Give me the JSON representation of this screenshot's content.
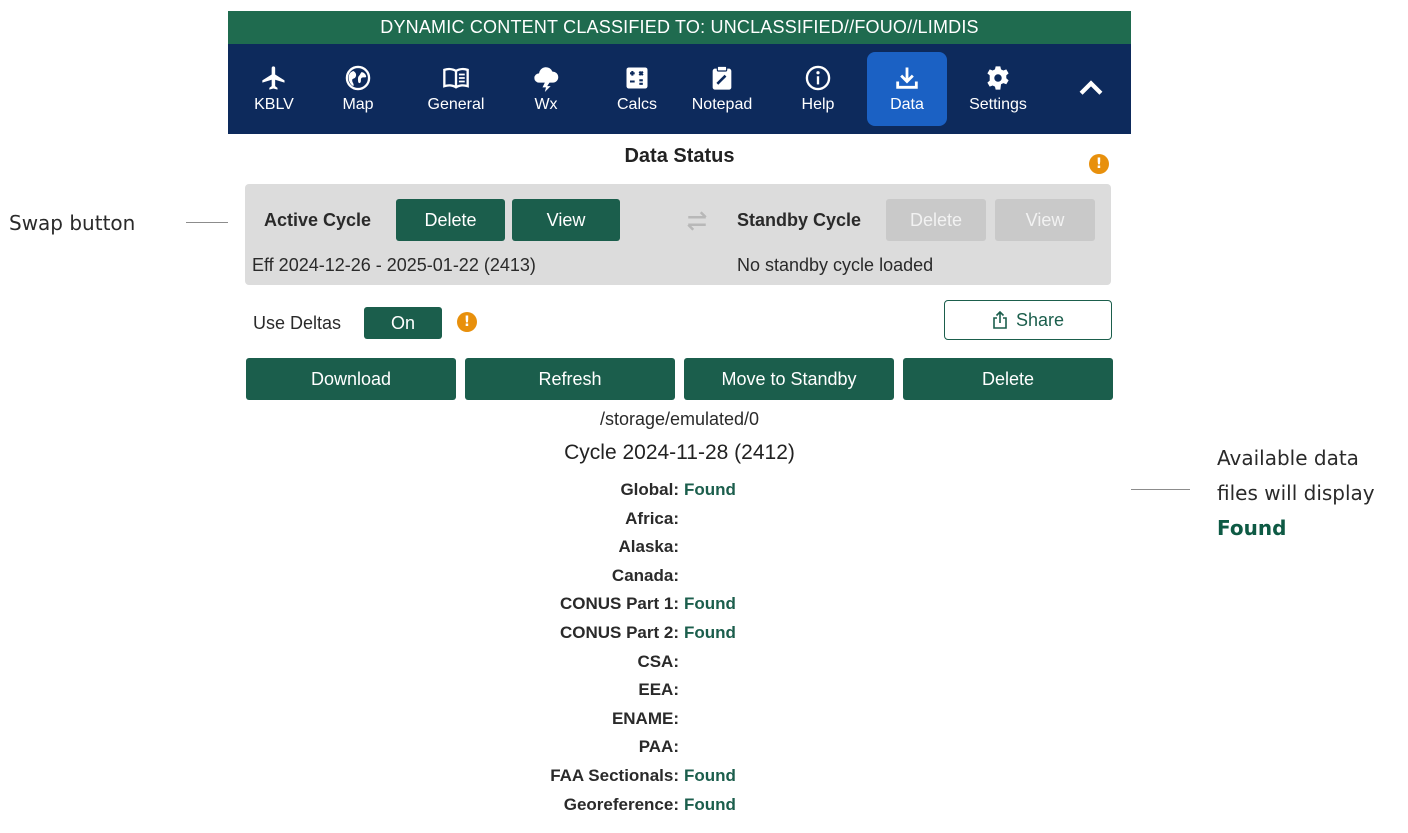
{
  "annotations": {
    "swap": "Swap button",
    "available_line1": "Available data",
    "available_line2": "files will display",
    "available_line3": "Found"
  },
  "banner": "DYNAMIC CONTENT CLASSIFIED TO: UNCLASSIFIED//FOUO//LIMDIS",
  "nav": {
    "items": [
      {
        "label": "KBLV",
        "icon": "airplane-icon"
      },
      {
        "label": "Map",
        "icon": "globe-icon"
      },
      {
        "label": "General",
        "icon": "book-icon"
      },
      {
        "label": "Wx",
        "icon": "weather-icon"
      },
      {
        "label": "Calcs",
        "icon": "calculator-icon"
      },
      {
        "label": "Notepad",
        "icon": "notepad-icon"
      },
      {
        "label": "Help",
        "icon": "info-icon"
      },
      {
        "label": "Data",
        "icon": "download-icon",
        "active": true
      },
      {
        "label": "Settings",
        "icon": "gear-icon"
      }
    ]
  },
  "title": "Data Status",
  "cycles": {
    "active_label": "Active Cycle",
    "active_info": "Eff 2024-12-26 - 2025-01-22 (2413)",
    "standby_label": "Standby Cycle",
    "standby_info": "No standby cycle loaded",
    "delete_label": "Delete",
    "view_label": "View"
  },
  "deltas": {
    "label": "Use Deltas",
    "value": "On"
  },
  "share_label": "Share",
  "actions": {
    "download": "Download",
    "refresh": "Refresh",
    "move": "Move to Standby",
    "delete": "Delete"
  },
  "storage_path": "/storage/emulated/0",
  "cycle_heading": "Cycle 2024-11-28 (2412)",
  "files": [
    {
      "label": "Global:",
      "status": "Found"
    },
    {
      "label": "Africa:",
      "status": ""
    },
    {
      "label": "Alaska:",
      "status": ""
    },
    {
      "label": "Canada:",
      "status": ""
    },
    {
      "label": "CONUS Part 1:",
      "status": "Found"
    },
    {
      "label": "CONUS Part 2:",
      "status": "Found"
    },
    {
      "label": "CSA:",
      "status": ""
    },
    {
      "label": "EEA:",
      "status": ""
    },
    {
      "label": "ENAME:",
      "status": ""
    },
    {
      "label": "PAA:",
      "status": ""
    },
    {
      "label": "FAA Sectionals:",
      "status": "Found"
    },
    {
      "label": "Georeference:",
      "status": "Found"
    }
  ],
  "colors": {
    "banner": "#1f6b4f",
    "nav_bg": "#0d2a5c",
    "nav_active": "#1b61c4",
    "button": "#1b5e4c",
    "info": "#e8900c"
  }
}
